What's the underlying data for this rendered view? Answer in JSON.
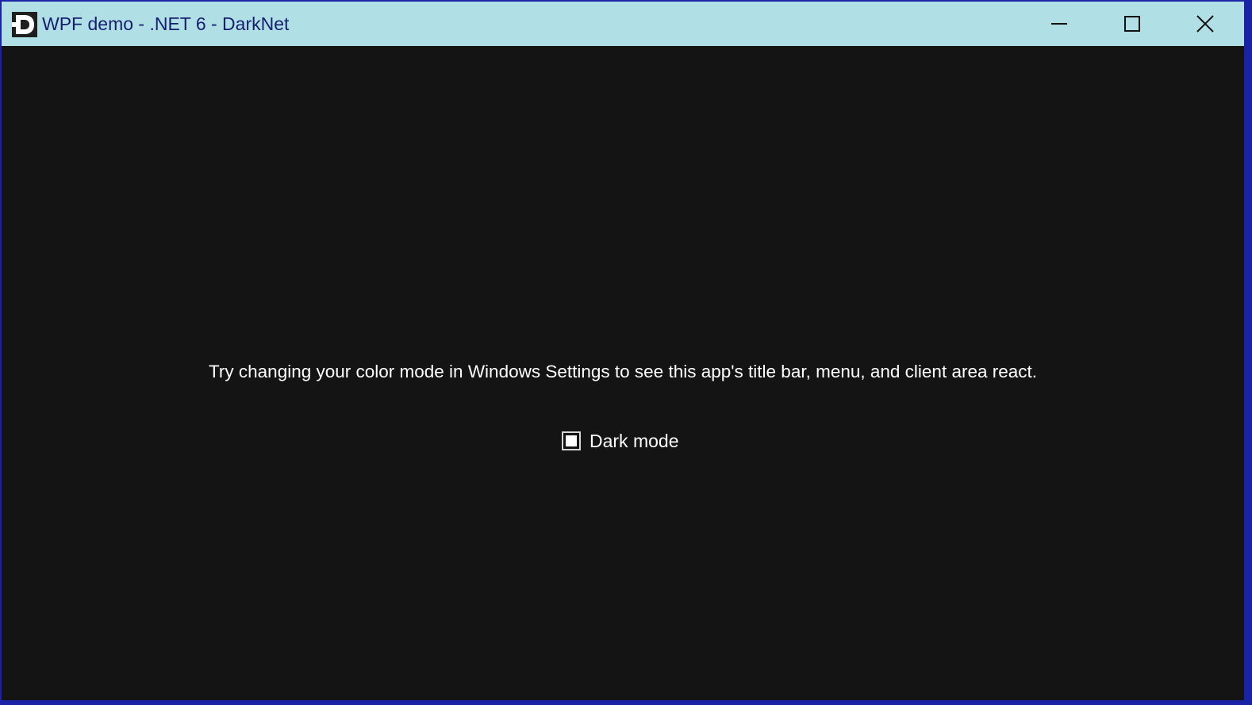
{
  "window": {
    "title": "WPF demo - .NET 6 - DarkNet",
    "icon": "darknet-logo-icon",
    "titlebar_color": "#b0dfe5",
    "title_color": "#151f6e",
    "border_color": "#1a22a8",
    "client_background": "#141414",
    "caption_buttons": {
      "minimize": "minimize-icon",
      "maximize": "maximize-icon",
      "close": "close-icon"
    }
  },
  "content": {
    "message": "Try changing your color mode in Windows Settings to see this app's title bar, menu, and client area react.",
    "dark_mode_checkbox": {
      "label": "Dark mode",
      "state": "indeterminate"
    }
  }
}
